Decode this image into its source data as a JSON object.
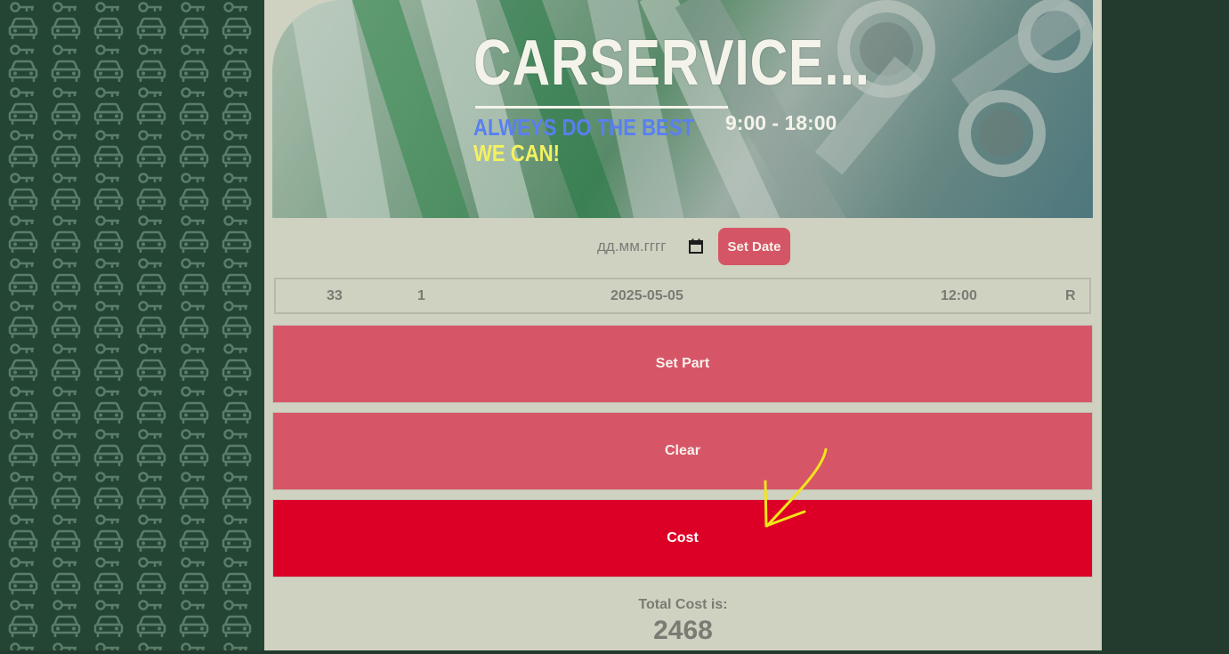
{
  "banner": {
    "title": "CARSERVICE...",
    "slogan_line1": "ALWEYS DO THE BEST",
    "slogan_line2": "WE CAN!",
    "hours": "9:00 - 18:00"
  },
  "date_picker": {
    "placeholder": "дд.мм.гггг",
    "set_date_label": "Set Date"
  },
  "selection_row": {
    "col1": "33",
    "col2": "1",
    "date": "2025-05-05",
    "time": "12:00",
    "col5": "R"
  },
  "buttons": {
    "set_part": "Set Part",
    "clear": "Clear",
    "cost": "Cost"
  },
  "total": {
    "label": "Total Cost is:",
    "value": "2468"
  },
  "colors": {
    "button": "#d65667",
    "cost_button": "#dc0027",
    "panel": "#cfd1c1",
    "background": "#233b2f",
    "annotation_arrow": "#f2e51b"
  },
  "icons": [
    "car-key-pattern",
    "calendar-icon",
    "arrow-annotation"
  ]
}
